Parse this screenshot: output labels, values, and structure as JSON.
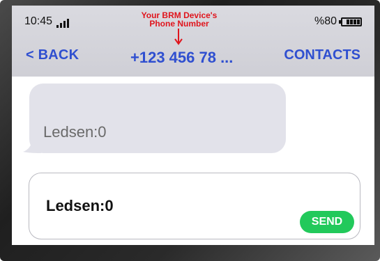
{
  "status_bar": {
    "time": "10:45",
    "battery_percent": "%80",
    "battery_level": 0.8
  },
  "annotation": {
    "line1": "Your BRM Device's",
    "line2": "Phone Number"
  },
  "nav": {
    "back_label": "< BACK",
    "phone_number": "+123 456 78 ...",
    "contacts_label": "CONTACTS"
  },
  "messages": [
    {
      "text": "Ledsen:0"
    }
  ],
  "composer": {
    "value": "Ledsen:0",
    "send_label": "SEND"
  },
  "colors": {
    "accent": "#2f4fd0",
    "annotation": "#e0141c",
    "send": "#22c95b",
    "bubble": "#e2e2ea"
  }
}
